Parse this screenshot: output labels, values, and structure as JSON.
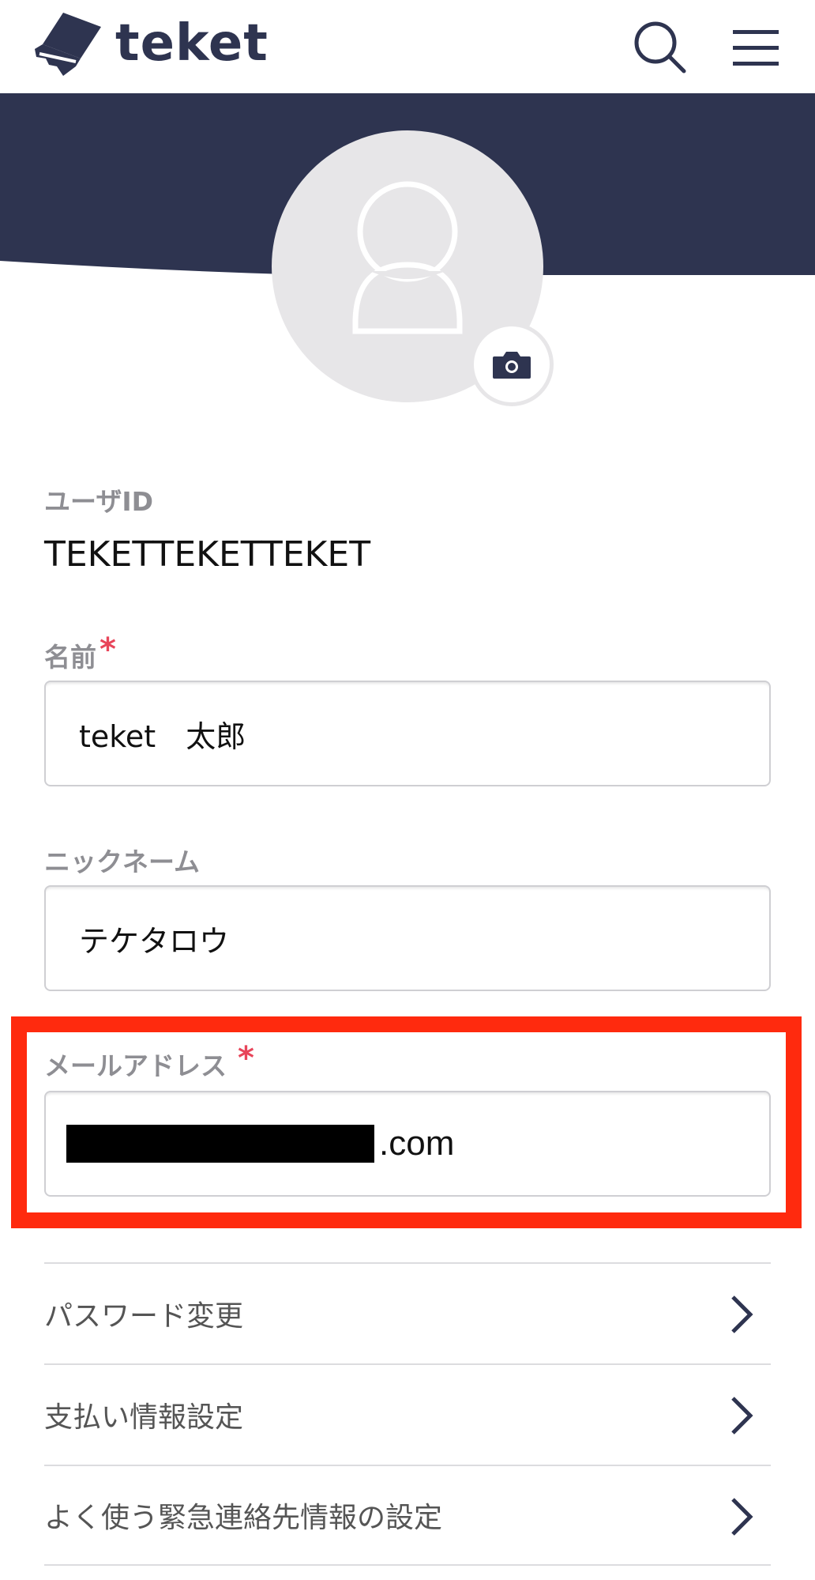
{
  "header": {
    "logo_text": "teket",
    "icons": [
      "search-icon",
      "hamburger-menu-icon"
    ]
  },
  "colors": {
    "brand_navy": "#2e3450",
    "required": "#e8455a",
    "highlight": "#ff2a0e",
    "label_gray": "#8e8e93",
    "avatar_bg": "#e7e6e8"
  },
  "profile": {
    "user_id_label": "ユーザID",
    "user_id_value": "TEKETTEKETTEKET",
    "name_label": "名前",
    "name_required": "*",
    "name_value": "teket　太郎",
    "nickname_label": "ニックネーム",
    "nickname_value": "テケタロウ",
    "email_label": "メールアドレス",
    "email_required": "*",
    "email_suffix": ".com"
  },
  "menu": {
    "items": [
      {
        "label": "パスワード変更"
      },
      {
        "label": "支払い情報設定"
      },
      {
        "label": "よく使う緊急連絡先情報の設定"
      }
    ]
  }
}
